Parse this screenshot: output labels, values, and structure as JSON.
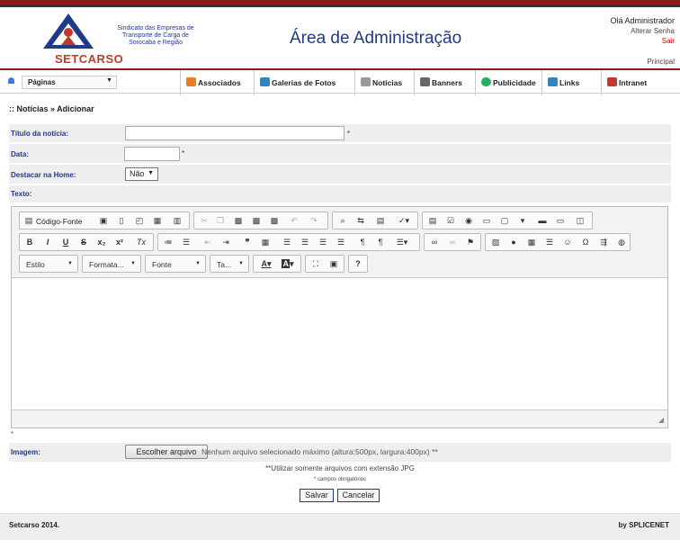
{
  "header": {
    "logo_text": "Sindicato das Empresas de Transporte de Carga de Sorocaba e Região",
    "logo_name": "SETCARSO",
    "page_title": "Área de Administração",
    "user_greeting": "Olá Administrador",
    "change_password": "Alterar Senha",
    "logout": "Sair",
    "principal": "Principal"
  },
  "nav": {
    "pages_label": "Páginas",
    "items": [
      {
        "label": "Associados",
        "color": "#e67e22"
      },
      {
        "label": "Galerias de Fotos",
        "color": "#2e86c1"
      },
      {
        "label": "Notícias",
        "color": "#555555"
      },
      {
        "label": "Banners",
        "color": "#555555"
      },
      {
        "label": "Publicidade",
        "color": "#27ae60"
      },
      {
        "label": "Links",
        "color": "#2e86c1"
      },
      {
        "label": "Intranet",
        "color": "#c0392b"
      }
    ]
  },
  "breadcrumb": ":: Notícias » Adicionar",
  "form": {
    "title_label": "Título da notícia:",
    "title_value": "",
    "date_label": "Data:",
    "date_value": "",
    "highlight_label": "Destacar na Home:",
    "highlight_value": "Não",
    "text_label": "Texto:",
    "required_mark": "*",
    "image_label": "Imagem:",
    "choose_file": "Escolher arquivo",
    "file_status": "Nenhum arquivo selecionado  máximo (altura:500px, largura:400px) **",
    "jpg_note": "**Utilizar somente arquivos com extensão JPG",
    "required_note": "* campos obrigatórios",
    "save": "Salvar",
    "cancel": "Cancelar"
  },
  "editor": {
    "source_label": "Código-Fonte",
    "style_dd": "Estilo",
    "format_dd": "Formata...",
    "font_dd": "Fonte",
    "size_dd": "Ta...",
    "text_color": "A",
    "bg_color": "A",
    "help": "?"
  },
  "footer": {
    "left": "Setcarso 2014.",
    "right": "by SPLICENET"
  }
}
